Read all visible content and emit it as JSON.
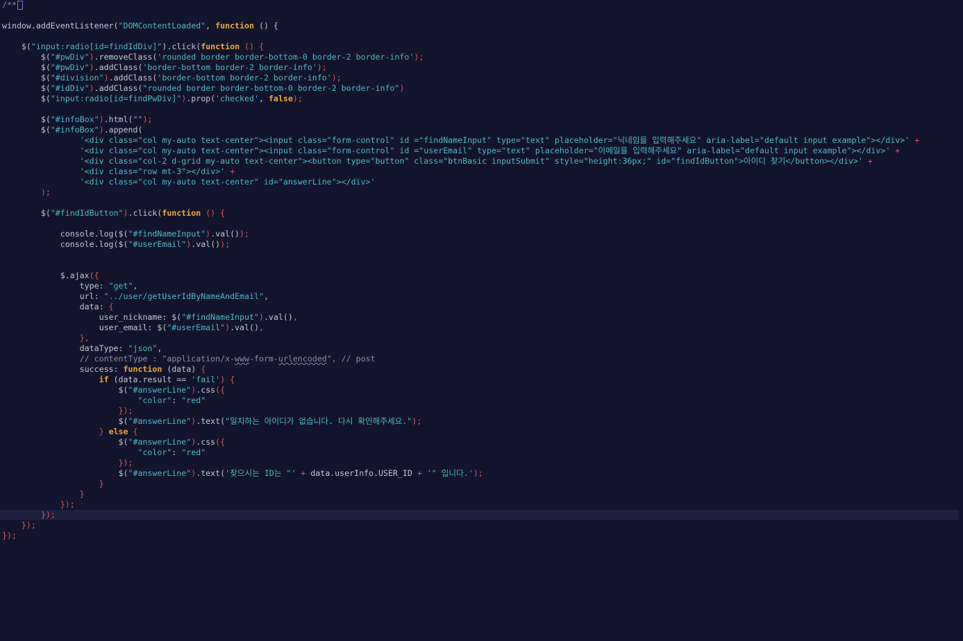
{
  "editor": {
    "lines": [
      [
        {
          "t": "c",
          "v": "/**"
        },
        {
          "t": "box",
          "v": ""
        }
      ],
      [],
      [
        {
          "t": "i",
          "v": "window.addEventListener("
        },
        {
          "t": "s",
          "v": "\"DOMContentLoaded\""
        },
        {
          "t": "i",
          "v": ", "
        },
        {
          "t": "k",
          "v": "function"
        },
        {
          "t": "i",
          "v": " () {"
        }
      ],
      [],
      [
        {
          "t": "i",
          "v": "    $("
        },
        {
          "t": "s",
          "v": "\"input:radio[id=findIdDiv]\""
        },
        {
          "t": "i",
          "v": ").click("
        },
        {
          "t": "k",
          "v": "function"
        },
        {
          "t": "p",
          "v": " () {"
        }
      ],
      [
        {
          "t": "i",
          "v": "        $("
        },
        {
          "t": "s",
          "v": "\"#pwDiv\""
        },
        {
          "t": "p",
          "v": ")"
        },
        {
          "t": "i",
          "v": ".removeClass("
        },
        {
          "t": "s",
          "v": "'rounded border border-bottom-0 border-2 border-info'"
        },
        {
          "t": "p",
          "v": ");"
        }
      ],
      [
        {
          "t": "i",
          "v": "        $("
        },
        {
          "t": "s",
          "v": "\"#pwDiv\""
        },
        {
          "t": "p",
          "v": ")"
        },
        {
          "t": "i",
          "v": ".addClass("
        },
        {
          "t": "s",
          "v": "'border-bottom border-2 border-info'"
        },
        {
          "t": "p",
          "v": ");"
        }
      ],
      [
        {
          "t": "i",
          "v": "        $("
        },
        {
          "t": "s",
          "v": "\"#division\""
        },
        {
          "t": "p",
          "v": ")"
        },
        {
          "t": "i",
          "v": ".addClass("
        },
        {
          "t": "s",
          "v": "'border-bottom border-2 border-info'"
        },
        {
          "t": "p",
          "v": ");"
        }
      ],
      [
        {
          "t": "i",
          "v": "        $("
        },
        {
          "t": "s",
          "v": "\"#idDiv\""
        },
        {
          "t": "p",
          "v": ")"
        },
        {
          "t": "i",
          "v": ".addClass("
        },
        {
          "t": "s",
          "v": "\"rounded border border-bottom-0 border-2 border-info\""
        },
        {
          "t": "p",
          "v": ")"
        }
      ],
      [
        {
          "t": "i",
          "v": "        $("
        },
        {
          "t": "s",
          "v": "\"input:radio[id=findPwDiv]\""
        },
        {
          "t": "p",
          "v": ")"
        },
        {
          "t": "i",
          "v": ".prop("
        },
        {
          "t": "s",
          "v": "'checked'"
        },
        {
          "t": "i",
          "v": ", "
        },
        {
          "t": "k",
          "v": "false"
        },
        {
          "t": "p",
          "v": ");"
        }
      ],
      [],
      [
        {
          "t": "i",
          "v": "        $("
        },
        {
          "t": "s",
          "v": "\"#infoBox\""
        },
        {
          "t": "p",
          "v": ")"
        },
        {
          "t": "i",
          "v": ".html("
        },
        {
          "t": "s",
          "v": "\"\""
        },
        {
          "t": "p",
          "v": ");"
        }
      ],
      [
        {
          "t": "i",
          "v": "        $("
        },
        {
          "t": "s",
          "v": "\"#infoBox\""
        },
        {
          "t": "p",
          "v": ")"
        },
        {
          "t": "i",
          "v": ".append("
        }
      ],
      [
        {
          "t": "i",
          "v": "                "
        },
        {
          "t": "s",
          "v": "'<div class=\"col my-auto text-center\"><input class=\"form-control\" id =\"findNameInput\" type=\"text\" placeholder=\"닉네임을 입력해주세요\" aria-label=\"default input example\"></div>'"
        },
        {
          "t": "p",
          "v": " +"
        }
      ],
      [
        {
          "t": "i",
          "v": "                "
        },
        {
          "t": "s",
          "v": "'<div class=\"col my-auto text-center\"><input class=\"form-control\" id =\"userEmail\" type=\"text\" placeholder=\"이메일을 입력해주세요\" aria-label=\"default input example\"></div>'"
        },
        {
          "t": "p",
          "v": " +"
        }
      ],
      [
        {
          "t": "i",
          "v": "                "
        },
        {
          "t": "s",
          "v": "'<div class=\"col-2 d-grid my-auto text-center\"><button type=\"button\" class=\"btnBasic inputSubmit\" style=\"height:36px;\" id=\"findIdButton\">아이디 찾기</button></div>'"
        },
        {
          "t": "p",
          "v": " +"
        }
      ],
      [
        {
          "t": "i",
          "v": "                "
        },
        {
          "t": "s",
          "v": "'<div class=\"row mt-3\"></div>'"
        },
        {
          "t": "p",
          "v": " +"
        }
      ],
      [
        {
          "t": "i",
          "v": "                "
        },
        {
          "t": "s",
          "v": "'<div class=\"col my-auto text-center\" id=\"answerLine\"></div>'"
        }
      ],
      [
        {
          "t": "p",
          "v": "        );"
        }
      ],
      [],
      [
        {
          "t": "i",
          "v": "        $("
        },
        {
          "t": "s",
          "v": "\"#findIdButton\""
        },
        {
          "t": "p",
          "v": ")"
        },
        {
          "t": "i",
          "v": ".click("
        },
        {
          "t": "k",
          "v": "function"
        },
        {
          "t": "p",
          "v": " () {"
        }
      ],
      [],
      [
        {
          "t": "i",
          "v": "            console.log($("
        },
        {
          "t": "s",
          "v": "\"#findNameInput\""
        },
        {
          "t": "p",
          "v": ")"
        },
        {
          "t": "i",
          "v": ".val()"
        },
        {
          "t": "p",
          "v": ");"
        }
      ],
      [
        {
          "t": "i",
          "v": "            console.log($("
        },
        {
          "t": "s",
          "v": "\"#userEmail\""
        },
        {
          "t": "p",
          "v": ")"
        },
        {
          "t": "i",
          "v": ".val()"
        },
        {
          "t": "p",
          "v": ");"
        }
      ],
      [],
      [],
      [
        {
          "t": "i",
          "v": "            $.ajax"
        },
        {
          "t": "p",
          "v": "({"
        }
      ],
      [
        {
          "t": "i",
          "v": "                type: "
        },
        {
          "t": "s",
          "v": "\"get\""
        },
        {
          "t": "i",
          "v": ","
        }
      ],
      [
        {
          "t": "i",
          "v": "                url: "
        },
        {
          "t": "s",
          "v": "\"../user/getUserIdByNameAndEmail\""
        },
        {
          "t": "i",
          "v": ","
        }
      ],
      [
        {
          "t": "i",
          "v": "                data: "
        },
        {
          "t": "p",
          "v": "{"
        }
      ],
      [
        {
          "t": "i",
          "v": "                    user_nickname: $("
        },
        {
          "t": "s",
          "v": "\"#findNameInput\""
        },
        {
          "t": "p",
          "v": ")"
        },
        {
          "t": "i",
          "v": ".val()"
        },
        {
          "t": "p",
          "v": ","
        }
      ],
      [
        {
          "t": "i",
          "v": "                    user_email: $("
        },
        {
          "t": "s",
          "v": "\"#userEmail\""
        },
        {
          "t": "p",
          "v": ")"
        },
        {
          "t": "i",
          "v": ".val()"
        },
        {
          "t": "p",
          "v": ","
        }
      ],
      [
        {
          "t": "p",
          "v": "                },"
        }
      ],
      [
        {
          "t": "i",
          "v": "                dataType: "
        },
        {
          "t": "s",
          "v": "\"json\""
        },
        {
          "t": "i",
          "v": ","
        }
      ],
      [
        {
          "t": "c",
          "v": "                // contentType : \"application/x-"
        },
        {
          "t": "cs",
          "v": "www"
        },
        {
          "t": "c",
          "v": "-form-"
        },
        {
          "t": "cs",
          "v": "urlencoded"
        },
        {
          "t": "c",
          "v": "\", // post"
        }
      ],
      [
        {
          "t": "i",
          "v": "                success: "
        },
        {
          "t": "k",
          "v": "function"
        },
        {
          "t": "i",
          "v": " (data) "
        },
        {
          "t": "p",
          "v": "{"
        }
      ],
      [
        {
          "t": "i",
          "v": "                    "
        },
        {
          "t": "k",
          "v": "if"
        },
        {
          "t": "i",
          "v": " (data.result == "
        },
        {
          "t": "s",
          "v": "'fail'"
        },
        {
          "t": "p",
          "v": ") {"
        }
      ],
      [
        {
          "t": "i",
          "v": "                        $("
        },
        {
          "t": "s",
          "v": "\"#answerLine\""
        },
        {
          "t": "p",
          "v": ")"
        },
        {
          "t": "i",
          "v": ".css"
        },
        {
          "t": "p",
          "v": "({"
        }
      ],
      [
        {
          "t": "i",
          "v": "                            "
        },
        {
          "t": "s",
          "v": "\"color\""
        },
        {
          "t": "i",
          "v": ": "
        },
        {
          "t": "s",
          "v": "\"red\""
        }
      ],
      [
        {
          "t": "p",
          "v": "                        });"
        }
      ],
      [
        {
          "t": "i",
          "v": "                        $("
        },
        {
          "t": "s",
          "v": "\"#answerLine\""
        },
        {
          "t": "p",
          "v": ")"
        },
        {
          "t": "i",
          "v": ".text("
        },
        {
          "t": "s",
          "v": "\"일치하는 아이디가 없습니다. 다시 확인해주세요.\""
        },
        {
          "t": "p",
          "v": ");"
        }
      ],
      [
        {
          "t": "p",
          "v": "                    } "
        },
        {
          "t": "k",
          "v": "else"
        },
        {
          "t": "p",
          "v": " {"
        }
      ],
      [
        {
          "t": "i",
          "v": "                        $("
        },
        {
          "t": "s",
          "v": "\"#answerLine\""
        },
        {
          "t": "p",
          "v": ")"
        },
        {
          "t": "i",
          "v": ".css"
        },
        {
          "t": "p",
          "v": "({"
        }
      ],
      [
        {
          "t": "i",
          "v": "                            "
        },
        {
          "t": "s",
          "v": "\"color\""
        },
        {
          "t": "i",
          "v": ": "
        },
        {
          "t": "s",
          "v": "\"red\""
        }
      ],
      [
        {
          "t": "p",
          "v": "                        });"
        }
      ],
      [
        {
          "t": "i",
          "v": "                        $("
        },
        {
          "t": "s",
          "v": "\"#answerLine\""
        },
        {
          "t": "p",
          "v": ")"
        },
        {
          "t": "i",
          "v": ".text("
        },
        {
          "t": "s",
          "v": "'찾으시는 ID는 \"'"
        },
        {
          "t": "p",
          "v": " + "
        },
        {
          "t": "i",
          "v": "data.userInfo.USER_ID "
        },
        {
          "t": "p",
          "v": "+ "
        },
        {
          "t": "s",
          "v": "'\" 입니다.'"
        },
        {
          "t": "p",
          "v": ");"
        }
      ],
      [
        {
          "t": "p",
          "v": "                    }"
        }
      ],
      [
        {
          "t": "p",
          "v": "                }"
        }
      ],
      [
        {
          "t": "p",
          "v": "            });"
        }
      ],
      [
        {
          "t": "p",
          "v": "        });"
        }
      ],
      [
        {
          "t": "p",
          "v": "    });"
        },
        {
          "t": "cursor",
          "v": ""
        }
      ],
      [
        {
          "t": "p",
          "v": "});"
        }
      ]
    ],
    "current_line": 49
  },
  "colors": {
    "background": "#12142b",
    "keyword": "#f2a640",
    "string": "#4fb8c9",
    "punctuation": "#e0545e",
    "comment": "#8a8fa3",
    "text": "#c5c8d6"
  }
}
